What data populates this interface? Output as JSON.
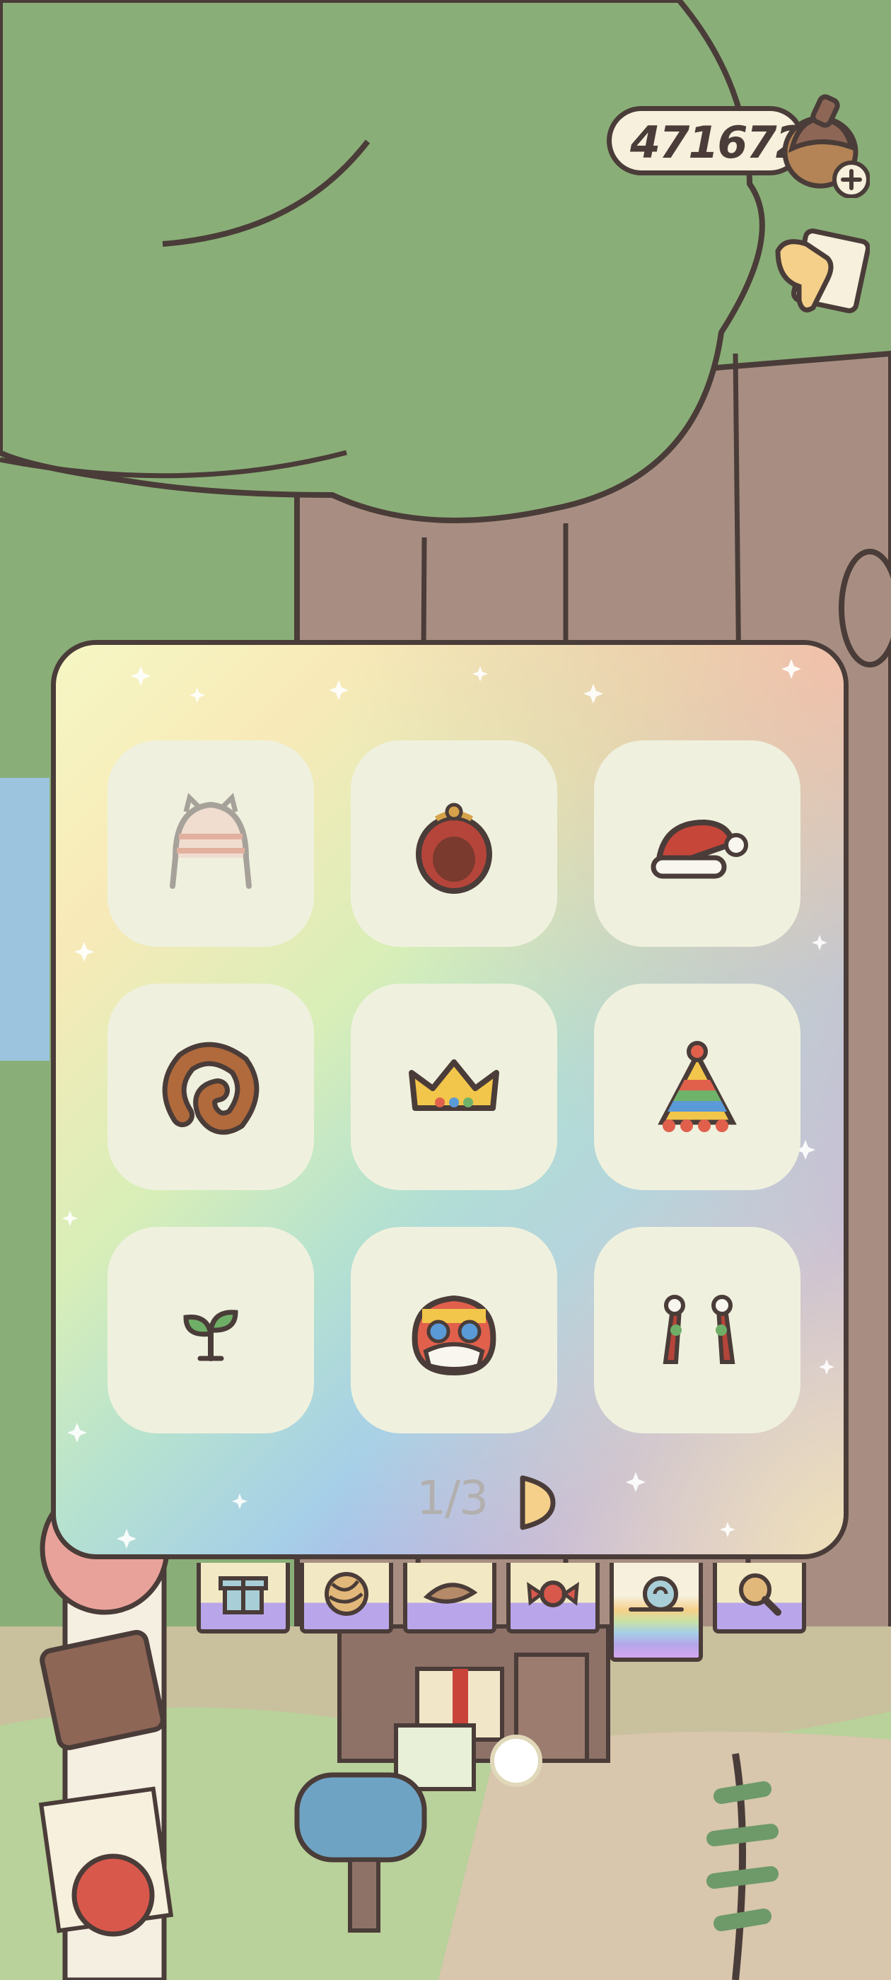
{
  "hud": {
    "currency_value": "471672",
    "currency_icon": "acorn-icon",
    "add_icon": "plus-icon",
    "hint_icon": "pointing-hand-icon"
  },
  "panel": {
    "items": [
      {
        "icon": "knit-hat-icon"
      },
      {
        "icon": "gourd-bag-icon"
      },
      {
        "icon": "santa-hat-icon"
      },
      {
        "icon": "pretzel-icon"
      },
      {
        "icon": "crown-icon"
      },
      {
        "icon": "party-hat-icon"
      },
      {
        "icon": "sprout-icon"
      },
      {
        "icon": "lion-dance-mask-icon"
      },
      {
        "icon": "cherry-hairclips-icon"
      }
    ],
    "page_indicator": "1/3",
    "next_icon": "next-page-arrow-icon"
  },
  "tabs": [
    {
      "icon": "gift-icon",
      "active": false
    },
    {
      "icon": "yarn-ball-icon",
      "active": false
    },
    {
      "icon": "leaf-icon",
      "active": false
    },
    {
      "icon": "candy-icon",
      "active": false
    },
    {
      "icon": "snail-icon",
      "active": true
    },
    {
      "icon": "magnifier-icon",
      "active": false
    }
  ],
  "colors": {
    "outline": "#4a3c38",
    "slot": "#eff1de",
    "tree_green": "#8aae78",
    "trunk": "#a88e82",
    "page_text": "#b2b0ae"
  }
}
